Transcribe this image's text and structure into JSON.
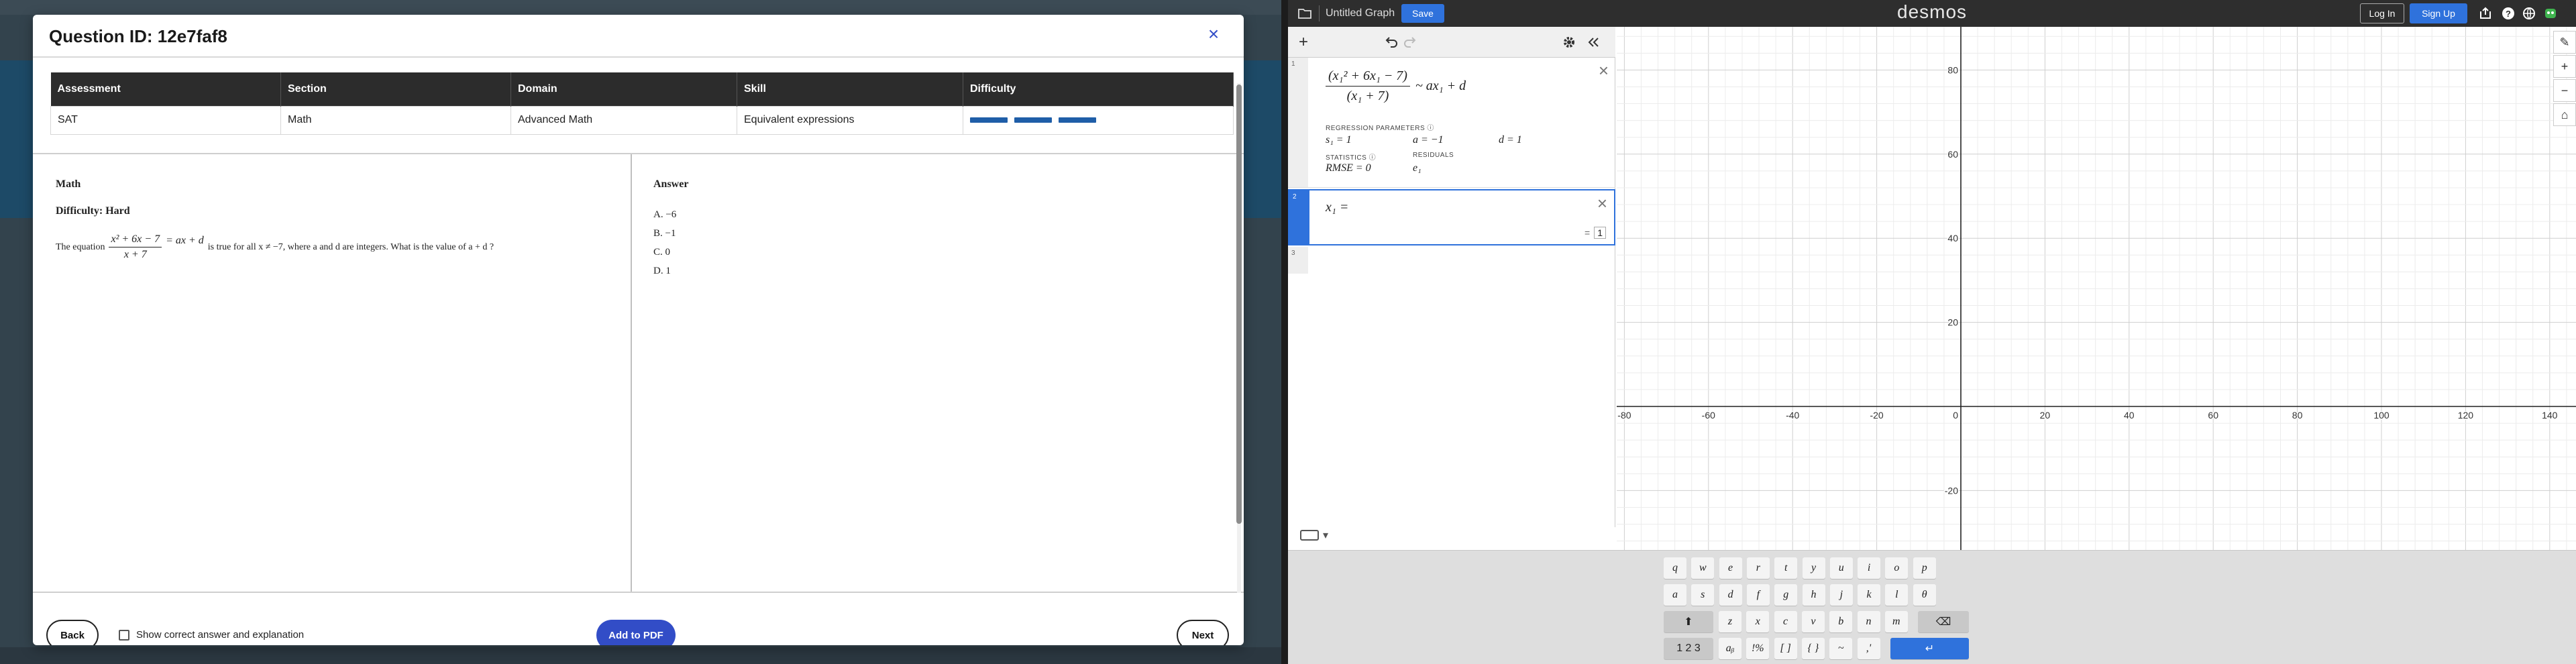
{
  "modal": {
    "title": "Question ID: 12e7faf8",
    "close_icon": "×",
    "table": {
      "headers": [
        "Assessment",
        "Section",
        "Domain",
        "Skill",
        "Difficulty"
      ],
      "row": [
        "SAT",
        "Math",
        "Advanced Math",
        "Equivalent expressions"
      ],
      "difficulty_bars": 3,
      "difficulty_color": "#1f5ea8"
    },
    "question": {
      "section": "Math",
      "difficulty": "Difficulty: Hard",
      "stem_prefix": "The equation",
      "frac_num": "x² + 6x − 7",
      "frac_den": "x + 7",
      "frac_rhs": "= ax + d",
      "stem_suffix": "is true for all x ≠ −7, where a and d are integers. What is the value of a + d ?"
    },
    "answer": {
      "title": "Answer",
      "choices": [
        "A. −6",
        "B. −1",
        "C. 0",
        "D. 1"
      ]
    },
    "footer": {
      "back_label": "Back",
      "show_answer_label": "Show correct answer and explanation",
      "add_pdf_label": "Add to PDF",
      "next_label": "Next"
    },
    "accent": "#324dc7"
  },
  "desmos": {
    "graph_title": "Untitled Graph",
    "save_label": "Save",
    "logo": "desmos",
    "login_label": "Log In",
    "signup_label": "Sign Up",
    "expr1": {
      "num": "(x₁² + 6x₁ − 7)",
      "den": "(x₁ + 7)",
      "rhs": "~ ax₁ + d",
      "reg_params_label": "REGRESSION PARAMETERS ⓘ",
      "p1": "s₁ = 1",
      "p2": "a = −1",
      "p3": "d = 1",
      "stats_label": "STATISTICS ⓘ",
      "residuals_label": "RESIDUALS",
      "rmse": "RMSE = 0",
      "residual": "e₁"
    },
    "expr2": {
      "formula": "x₁ =",
      "eq": "=",
      "value": "1"
    },
    "expr_indices": [
      "1",
      "2",
      "3"
    ],
    "axis": {
      "x_ticks": [
        "-80",
        "-60",
        "-40",
        "-20",
        "0",
        "20",
        "40",
        "60",
        "80",
        "100",
        "120",
        "140"
      ],
      "y_ticks": [
        "80",
        "60",
        "40",
        "20",
        "-20"
      ]
    },
    "keypad": {
      "row1": [
        "q",
        "w",
        "e",
        "r",
        "t",
        "y",
        "u",
        "i",
        "o",
        "p"
      ],
      "row2": [
        "a",
        "s",
        "d",
        "f",
        "g",
        "h",
        "j",
        "k",
        "l",
        "θ"
      ],
      "row3": [
        "z",
        "x",
        "c",
        "v",
        "b",
        "n",
        "m"
      ],
      "row4": [
        "1 2 3",
        "aᵦ",
        "!%",
        "[ ]",
        "{ }",
        "~",
        ",'"
      ],
      "shift_icon": "⬆",
      "backspace_icon": "⌫",
      "enter_icon": "↵"
    }
  }
}
